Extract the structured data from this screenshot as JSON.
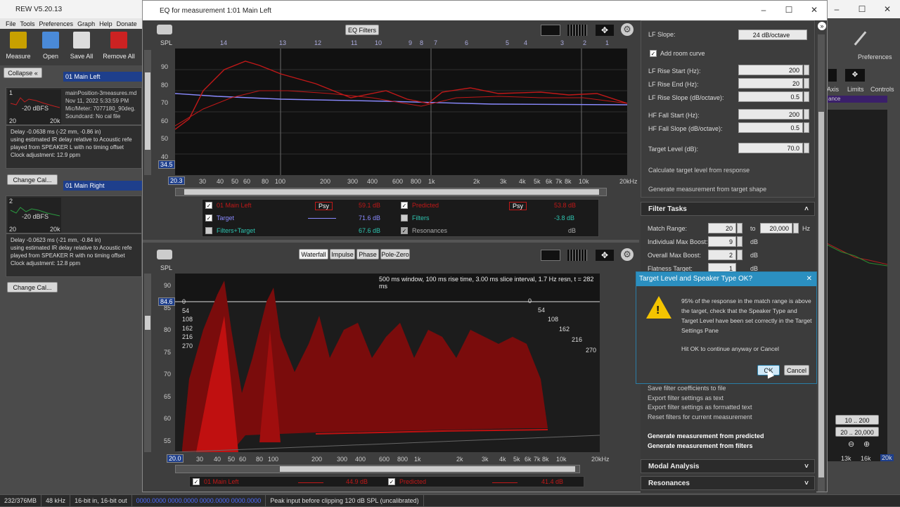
{
  "rew": {
    "title": "REW V5.20.13",
    "menu": [
      "File",
      "Tools",
      "Preferences",
      "Graph",
      "Help",
      "Donate"
    ],
    "toolbar": [
      {
        "label": "Measure"
      },
      {
        "label": "Open"
      },
      {
        "label": "Save All"
      },
      {
        "label": "Remove All"
      }
    ],
    "collapse": "Collapse",
    "meas": [
      {
        "num": "1",
        "name": "01 Main Left",
        "level": "-20 dBFS",
        "file": "mainPosition-3measures.md",
        "date": "Nov 11, 2022 5:33:59 PM",
        "mic": "Mic/Meter: 7077180_90deg.",
        "sound": "Soundcard: No cal file",
        "delay": "Delay -0.0638 ms (-22 mm, -0.86 in)",
        "info1": "using estimated IR delay relative to Acoustic refe",
        "info2": "played from SPEAKER L with no timing offset",
        "clock": "Clock adjustment: 12.9 ppm",
        "cal": "Change Cal...",
        "ax0": "20",
        "ax1": "20k"
      },
      {
        "num": "2",
        "name": "01 Main Right",
        "level": "-20 dBFS",
        "delay": "Delay -0.0623 ms (-21 mm, -0.84 in)",
        "info1": "using estimated IR delay relative to Acoustic refe",
        "info2": "played from SPEAKER R with no timing offset",
        "clock": "Clock adjustment: 12.8 ppm",
        "cal": "Change Cal...",
        "ax0": "20",
        "ax1": "20k"
      }
    ],
    "right": {
      "prefs": "Preferences",
      "axis": "Axis",
      "limits": "Limits",
      "controls": "Controls",
      "ance": "ance",
      "r1": "10 .. 200",
      "r2": "20 .. 20,000",
      "k13": "13k",
      "k16": "16k",
      "k20": "20k"
    }
  },
  "status": [
    "232/376MB",
    "48 kHz",
    "16-bit in, 16-bit out",
    "0000.0000  0000.0000  0000.0000  0000.0000",
    "Peak input before clipping 120 dB SPL (uncalibrated)"
  ],
  "eq": {
    "title": "EQ for measurement 1:01 Main Left",
    "filters_btn": "EQ Filters",
    "spl": "SPL",
    "filter_nums": [
      "14",
      "13",
      "12",
      "11",
      "10",
      "9",
      "8",
      "7",
      "6",
      "5",
      "4",
      "3",
      "2",
      "1"
    ],
    "yticks": [
      "90",
      "80",
      "70",
      "60",
      "50",
      "40"
    ],
    "ymark": "34.5",
    "xstart": "20.3",
    "xticks": [
      "30",
      "40",
      "50",
      "60",
      "80",
      "100",
      "200",
      "300",
      "400",
      "600",
      "800",
      "1k",
      "2k",
      "3k",
      "4k",
      "5k",
      "6k",
      "7k",
      "8k",
      "10k",
      "20kHz"
    ],
    "legend": [
      {
        "name": "01 Main Left",
        "psy": "Psy",
        "val": "59.1 dB",
        "color": "#c01818"
      },
      {
        "name": "Predicted",
        "psy": "Psy",
        "val": "53.8 dB",
        "color": "#c01818"
      },
      {
        "name": "Target",
        "val": "71.6 dB",
        "color": "#8a8aff"
      },
      {
        "name": "Filters",
        "val": "-3.8 dB",
        "color": "#2ec4b0"
      },
      {
        "name": "Filters+Target",
        "val": "67.6 dB",
        "color": "#2ec4b0"
      },
      {
        "name": "Resonances",
        "val": "dB",
        "color": "#aaa"
      }
    ],
    "tabs": [
      "Waterfall",
      "Impulse",
      "Phase",
      "Pole-Zero"
    ],
    "wf_info": "500 ms window, 100 ms rise time, 3.00 ms slice interval, 1.7 Hz resn, t = 282 ms",
    "wf_yticks": [
      "90",
      "85",
      "80",
      "75",
      "70",
      "65",
      "60",
      "55"
    ],
    "wf_ymark": "84.6",
    "wf_times": [
      "0",
      "54",
      "108",
      "162",
      "216",
      "270"
    ],
    "wf_times_r": [
      "0",
      "54",
      "108",
      "162",
      "216",
      "270"
    ],
    "wf_xstart": "20.0",
    "wf_xticks": [
      "30",
      "40",
      "50",
      "60",
      "80",
      "100",
      "200",
      "300",
      "400",
      "600",
      "800",
      "1k",
      "2k",
      "3k",
      "4k",
      "5k",
      "6k",
      "7k",
      "8k",
      "10k",
      "20kHz"
    ],
    "wf_legend": [
      {
        "name": "01 Main Left",
        "val": "44.9 dB"
      },
      {
        "name": "Predicted",
        "val": "41.4 dB"
      }
    ],
    "settings": [
      {
        "label": "LF Slope:",
        "value": "24 dB/octave"
      },
      {
        "label": "Add room curve"
      },
      {
        "label": "LF Rise Start (Hz):",
        "value": "200"
      },
      {
        "label": "LF Rise End (Hz):",
        "value": "20"
      },
      {
        "label": "LF Rise Slope (dB/octave):",
        "value": "0.5"
      },
      {
        "label": "HF Fall Start (Hz):",
        "value": "200"
      },
      {
        "label": "HF Fall Slope (dB/octave):",
        "value": "0.5"
      },
      {
        "label": "Target Level (dB):",
        "value": "70.0"
      }
    ],
    "calc_target": "Calculate target level from response",
    "gen_target": "Generate measurement from target shape",
    "filter_tasks": "Filter Tasks",
    "match_range": "Match Range:",
    "mr_from": "20",
    "mr_to_lbl": "to",
    "mr_to": "20,000",
    "mr_unit": "Hz",
    "ind_boost": "Individual Max Boost:",
    "ind_val": "9",
    "ind_unit": "dB",
    "ovr_boost": "Overall Max Boost:",
    "ovr_val": "2",
    "ovr_unit": "dB",
    "flat": "Flatness Target:",
    "flat_val": "1",
    "flat_unit": "dB",
    "actions": [
      "Save filter coefficients to file",
      "Export filter settings as text",
      "Export filter settings as formatted text",
      "Reset filters for current measurement"
    ],
    "gen1": "Generate measurement from predicted",
    "gen2": "Generate measurement from filters",
    "modal": "Modal Analysis",
    "reson": "Resonances"
  },
  "dialog": {
    "title": "Target Level and Speaker Type OK?",
    "msg": "95% of the response in the match range is above the target, check that the Speaker Type and Target Level have been set correctly in the Target Settings Pane",
    "msg2": "Hit OK to continue anyway or Cancel",
    "ok": "OK",
    "cancel": "Cancel"
  }
}
